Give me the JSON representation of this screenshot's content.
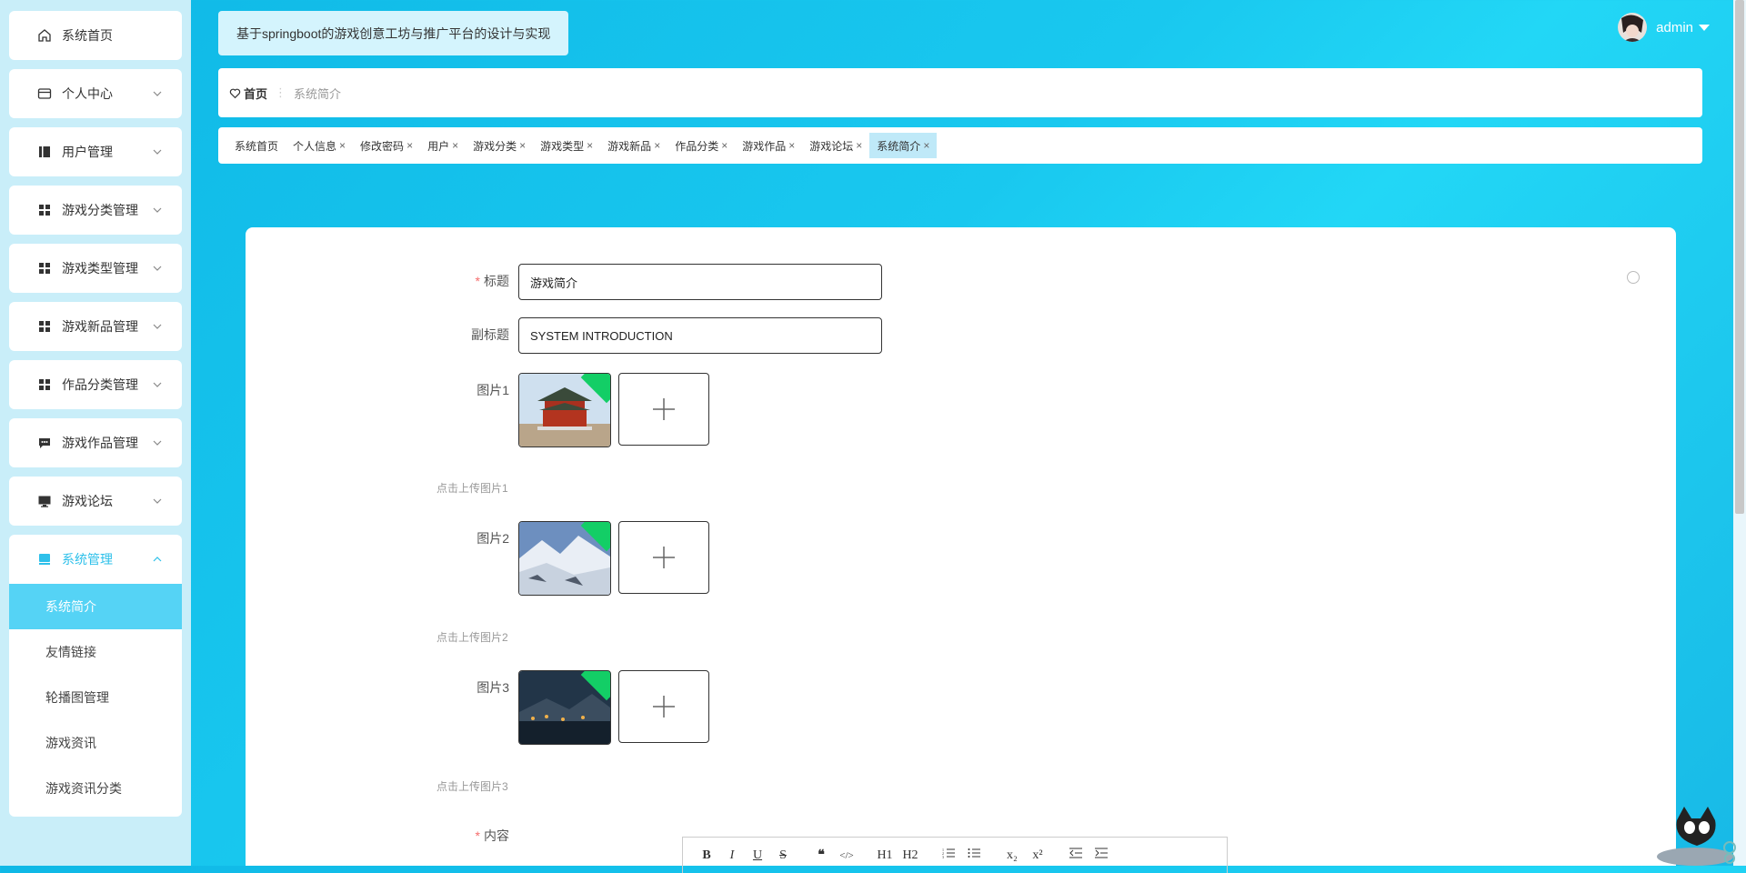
{
  "app": {
    "title": "基于springboot的游戏创意工坊与推广平台的设计与实现"
  },
  "user": {
    "name": "admin"
  },
  "sidebar": {
    "items": [
      {
        "label": "系统首页",
        "icon": "home-icon"
      },
      {
        "label": "个人中心",
        "icon": "card-icon"
      },
      {
        "label": "用户管理",
        "icon": "book-icon"
      },
      {
        "label": "游戏分类管理",
        "icon": "grid-icon"
      },
      {
        "label": "游戏类型管理",
        "icon": "grid-icon"
      },
      {
        "label": "游戏新品管理",
        "icon": "grid-icon"
      },
      {
        "label": "作品分类管理",
        "icon": "grid-icon"
      },
      {
        "label": "游戏作品管理",
        "icon": "chat-icon"
      },
      {
        "label": "游戏论坛",
        "icon": "monitor-icon"
      },
      {
        "label": "系统管理",
        "icon": "box-icon"
      }
    ],
    "submenu": [
      {
        "label": "系统简介"
      },
      {
        "label": "友情链接"
      },
      {
        "label": "轮播图管理"
      },
      {
        "label": "游戏资讯"
      },
      {
        "label": "游戏资讯分类"
      }
    ]
  },
  "breadcrumb": {
    "home": "首页",
    "current": "系统简介"
  },
  "tags": [
    "系统首页",
    "个人信息",
    "修改密码",
    "用户",
    "游戏分类",
    "游戏类型",
    "游戏新品",
    "作品分类",
    "游戏作品",
    "游戏论坛",
    "系统简介"
  ],
  "form": {
    "title_label": "标题",
    "title_value": "游戏简介",
    "subtitle_label": "副标题",
    "subtitle_value": "SYSTEM INTRODUCTION",
    "pic1_label": "图片1",
    "pic1_hint": "点击上传图片1",
    "pic2_label": "图片2",
    "pic2_hint": "点击上传图片2",
    "pic3_label": "图片3",
    "pic3_hint": "点击上传图片3",
    "content_label": "内容",
    "required_mark": "*"
  },
  "editor_toolbar": [
    "B",
    "I",
    "U",
    "S",
    "❝",
    "</>",
    "H1",
    "H2",
    "ol",
    "ul",
    "x₂",
    "x²",
    "outdent",
    "indent"
  ],
  "colors": {
    "accent": "#2ec0ea",
    "active_sub": "#55d3f5",
    "required": "#f56c6c"
  }
}
